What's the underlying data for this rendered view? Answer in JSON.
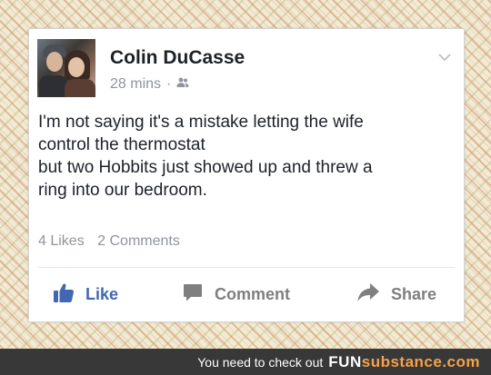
{
  "post": {
    "author": "Colin DuCasse",
    "time": "28 mins",
    "separator": "·",
    "audience_icon": "friends-icon",
    "lines": [
      "I'm not saying it's a mistake letting the wife",
      "control the thermostat",
      "but two Hobbits just showed up and threw a",
      "ring into our bedroom."
    ],
    "likes": "4 Likes",
    "comments": "2 Comments"
  },
  "actions": {
    "like": "Like",
    "comment": "Comment",
    "share": "Share"
  },
  "footer": {
    "text": "You need to check out",
    "brand_part1": "FUN",
    "brand_part2": "substance.com"
  },
  "colors": {
    "like_blue": "#4267b2",
    "text": "#1d2129",
    "meta": "#90949c",
    "footer_bg": "#383838",
    "brand_orange": "#f6a24a"
  }
}
